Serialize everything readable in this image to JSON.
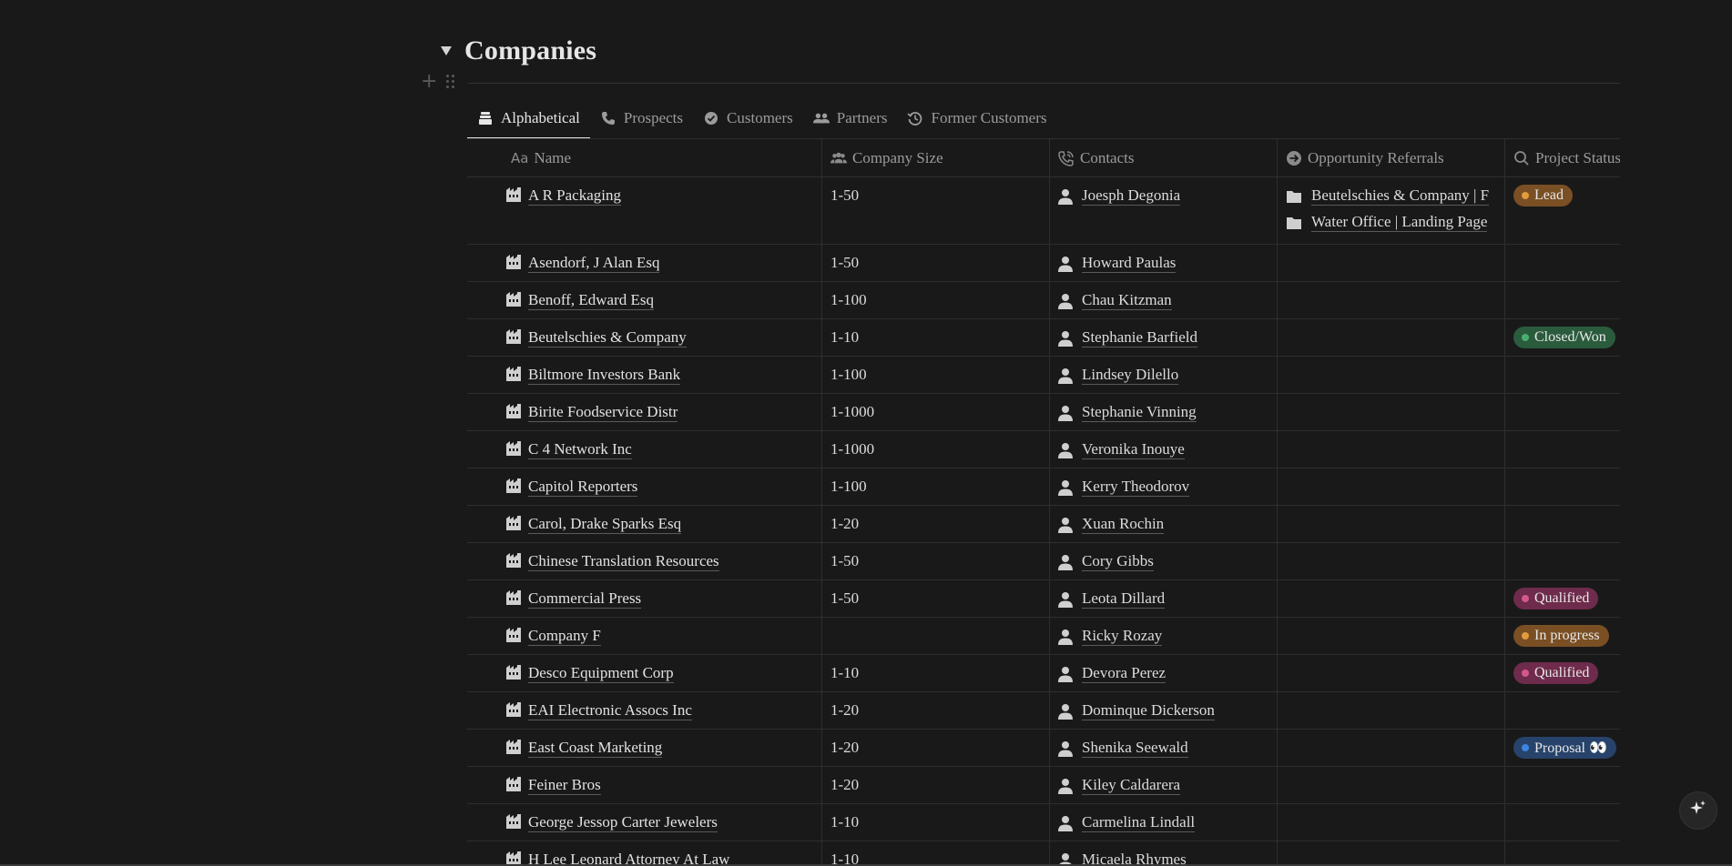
{
  "page": {
    "title": "Companies"
  },
  "tabs": [
    {
      "label": "Alphabetical",
      "icon": "stack-icon",
      "active": true
    },
    {
      "label": "Prospects",
      "icon": "phone-icon",
      "active": false
    },
    {
      "label": "Customers",
      "icon": "check-circle-icon",
      "active": false
    },
    {
      "label": "Partners",
      "icon": "people-icon",
      "active": false
    },
    {
      "label": "Former Customers",
      "icon": "history-icon",
      "active": false
    }
  ],
  "columns": {
    "name": "Name",
    "name_icon_text": "Aa",
    "size": "Company Size",
    "contacts": "Contacts",
    "opportunities": "Opportunity Referrals",
    "status": "Project Status"
  },
  "rows": [
    {
      "name": "A R Packaging",
      "size": "1-50",
      "contact": "Joesph Degonia",
      "opportunities": [
        "Beutelschies & Company | F",
        "Water Office | Landing Page"
      ],
      "status": "Lead",
      "status_kind": "lead"
    },
    {
      "name": "Asendorf, J Alan Esq",
      "size": "1-50",
      "contact": "Howard Paulas",
      "opportunities": [],
      "status": "",
      "status_kind": ""
    },
    {
      "name": "Benoff, Edward Esq",
      "size": "1-100",
      "contact": "Chau Kitzman",
      "opportunities": [],
      "status": "",
      "status_kind": ""
    },
    {
      "name": "Beutelschies & Company",
      "size": "1-10",
      "contact": "Stephanie Barfield",
      "opportunities": [],
      "status": "Closed/Won",
      "status_kind": "closed"
    },
    {
      "name": "Biltmore Investors Bank",
      "size": "1-100",
      "contact": "Lindsey Dilello",
      "opportunities": [],
      "status": "",
      "status_kind": ""
    },
    {
      "name": "Birite Foodservice Distr",
      "size": "1-1000",
      "contact": "Stephanie Vinning",
      "opportunities": [],
      "status": "",
      "status_kind": ""
    },
    {
      "name": "C 4 Network Inc",
      "size": "1-1000",
      "contact": "Veronika Inouye",
      "opportunities": [],
      "status": "",
      "status_kind": ""
    },
    {
      "name": "Capitol Reporters",
      "size": "1-100",
      "contact": "Kerry Theodorov",
      "opportunities": [],
      "status": "",
      "status_kind": ""
    },
    {
      "name": "Carol, Drake Sparks Esq",
      "size": "1-20",
      "contact": "Xuan Rochin",
      "opportunities": [],
      "status": "",
      "status_kind": ""
    },
    {
      "name": "Chinese Translation Resources",
      "size": "1-50",
      "contact": "Cory Gibbs",
      "opportunities": [],
      "status": "",
      "status_kind": ""
    },
    {
      "name": "Commercial Press",
      "size": "1-50",
      "contact": "Leota Dillard",
      "opportunities": [],
      "status": "Qualified",
      "status_kind": "qualified"
    },
    {
      "name": "Company F",
      "size": "",
      "contact": "Ricky Rozay",
      "opportunities": [],
      "status": "In progress",
      "status_kind": "progress"
    },
    {
      "name": "Desco Equipment Corp",
      "size": "1-10",
      "contact": "Devora Perez",
      "opportunities": [],
      "status": "Qualified",
      "status_kind": "qualified"
    },
    {
      "name": "EAI Electronic Assocs Inc",
      "size": "1-20",
      "contact": "Dominque Dickerson",
      "opportunities": [],
      "status": "",
      "status_kind": ""
    },
    {
      "name": "East Coast Marketing",
      "size": "1-20",
      "contact": "Shenika Seewald",
      "opportunities": [],
      "status": "Proposal 👀",
      "status_kind": "proposal"
    },
    {
      "name": "Feiner Bros",
      "size": "1-20",
      "contact": "Kiley Caldarera",
      "opportunities": [],
      "status": "",
      "status_kind": ""
    },
    {
      "name": "George Jessop Carter Jewelers",
      "size": "1-10",
      "contact": "Carmelina Lindall",
      "opportunities": [],
      "status": "",
      "status_kind": ""
    },
    {
      "name": "H Lee Leonard Attorney At Law",
      "size": "1-10",
      "contact": "Micaela Rhymes",
      "opportunities": [],
      "status": "",
      "status_kind": ""
    }
  ],
  "colors": {
    "background": "#191919",
    "text": "#d4d4d4",
    "muted": "#9b9b9b",
    "border": "#2e2e2e"
  }
}
